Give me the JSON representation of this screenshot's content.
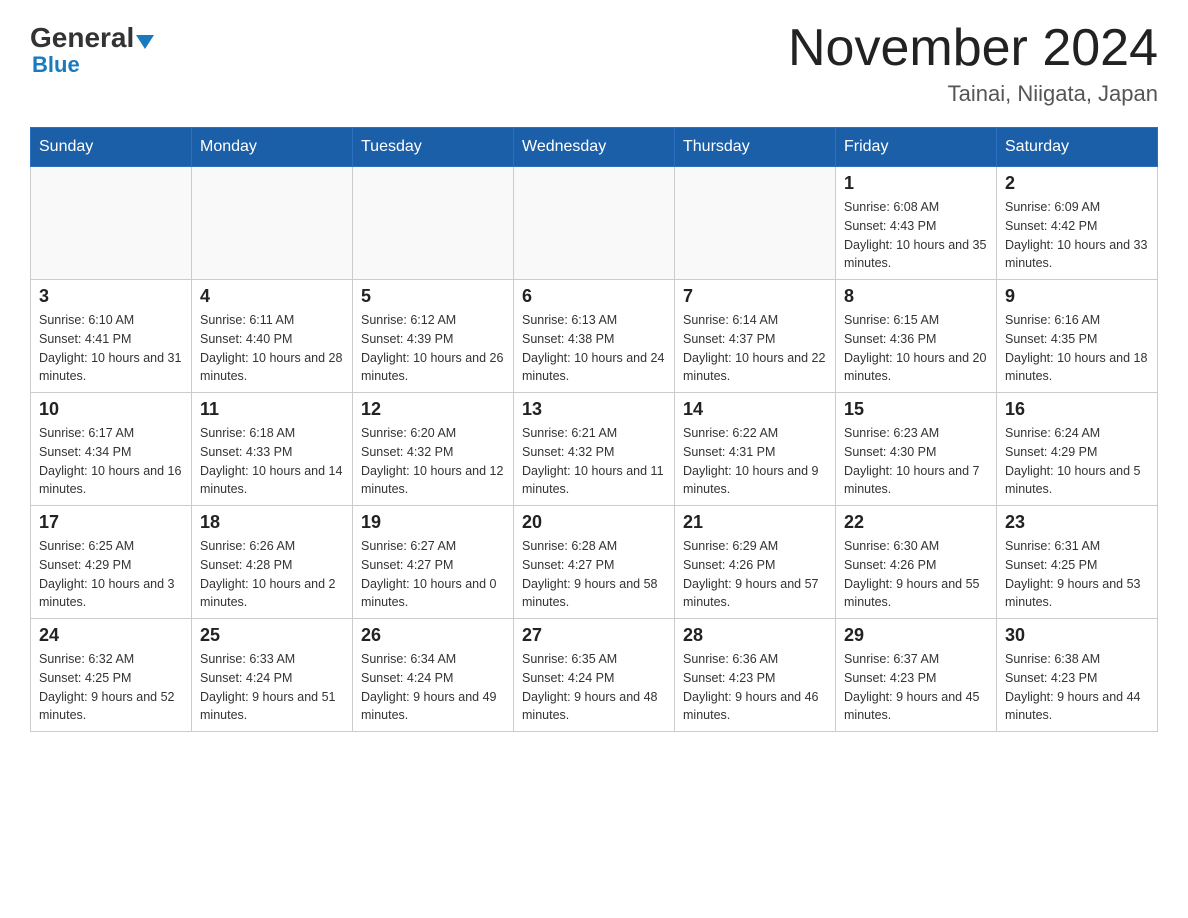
{
  "logo": {
    "general": "General",
    "blue": "Blue"
  },
  "header": {
    "title": "November 2024",
    "subtitle": "Tainai, Niigata, Japan"
  },
  "weekdays": [
    "Sunday",
    "Monday",
    "Tuesday",
    "Wednesday",
    "Thursday",
    "Friday",
    "Saturday"
  ],
  "weeks": [
    [
      {
        "day": "",
        "info": ""
      },
      {
        "day": "",
        "info": ""
      },
      {
        "day": "",
        "info": ""
      },
      {
        "day": "",
        "info": ""
      },
      {
        "day": "",
        "info": ""
      },
      {
        "day": "1",
        "info": "Sunrise: 6:08 AM\nSunset: 4:43 PM\nDaylight: 10 hours and 35 minutes."
      },
      {
        "day": "2",
        "info": "Sunrise: 6:09 AM\nSunset: 4:42 PM\nDaylight: 10 hours and 33 minutes."
      }
    ],
    [
      {
        "day": "3",
        "info": "Sunrise: 6:10 AM\nSunset: 4:41 PM\nDaylight: 10 hours and 31 minutes."
      },
      {
        "day": "4",
        "info": "Sunrise: 6:11 AM\nSunset: 4:40 PM\nDaylight: 10 hours and 28 minutes."
      },
      {
        "day": "5",
        "info": "Sunrise: 6:12 AM\nSunset: 4:39 PM\nDaylight: 10 hours and 26 minutes."
      },
      {
        "day": "6",
        "info": "Sunrise: 6:13 AM\nSunset: 4:38 PM\nDaylight: 10 hours and 24 minutes."
      },
      {
        "day": "7",
        "info": "Sunrise: 6:14 AM\nSunset: 4:37 PM\nDaylight: 10 hours and 22 minutes."
      },
      {
        "day": "8",
        "info": "Sunrise: 6:15 AM\nSunset: 4:36 PM\nDaylight: 10 hours and 20 minutes."
      },
      {
        "day": "9",
        "info": "Sunrise: 6:16 AM\nSunset: 4:35 PM\nDaylight: 10 hours and 18 minutes."
      }
    ],
    [
      {
        "day": "10",
        "info": "Sunrise: 6:17 AM\nSunset: 4:34 PM\nDaylight: 10 hours and 16 minutes."
      },
      {
        "day": "11",
        "info": "Sunrise: 6:18 AM\nSunset: 4:33 PM\nDaylight: 10 hours and 14 minutes."
      },
      {
        "day": "12",
        "info": "Sunrise: 6:20 AM\nSunset: 4:32 PM\nDaylight: 10 hours and 12 minutes."
      },
      {
        "day": "13",
        "info": "Sunrise: 6:21 AM\nSunset: 4:32 PM\nDaylight: 10 hours and 11 minutes."
      },
      {
        "day": "14",
        "info": "Sunrise: 6:22 AM\nSunset: 4:31 PM\nDaylight: 10 hours and 9 minutes."
      },
      {
        "day": "15",
        "info": "Sunrise: 6:23 AM\nSunset: 4:30 PM\nDaylight: 10 hours and 7 minutes."
      },
      {
        "day": "16",
        "info": "Sunrise: 6:24 AM\nSunset: 4:29 PM\nDaylight: 10 hours and 5 minutes."
      }
    ],
    [
      {
        "day": "17",
        "info": "Sunrise: 6:25 AM\nSunset: 4:29 PM\nDaylight: 10 hours and 3 minutes."
      },
      {
        "day": "18",
        "info": "Sunrise: 6:26 AM\nSunset: 4:28 PM\nDaylight: 10 hours and 2 minutes."
      },
      {
        "day": "19",
        "info": "Sunrise: 6:27 AM\nSunset: 4:27 PM\nDaylight: 10 hours and 0 minutes."
      },
      {
        "day": "20",
        "info": "Sunrise: 6:28 AM\nSunset: 4:27 PM\nDaylight: 9 hours and 58 minutes."
      },
      {
        "day": "21",
        "info": "Sunrise: 6:29 AM\nSunset: 4:26 PM\nDaylight: 9 hours and 57 minutes."
      },
      {
        "day": "22",
        "info": "Sunrise: 6:30 AM\nSunset: 4:26 PM\nDaylight: 9 hours and 55 minutes."
      },
      {
        "day": "23",
        "info": "Sunrise: 6:31 AM\nSunset: 4:25 PM\nDaylight: 9 hours and 53 minutes."
      }
    ],
    [
      {
        "day": "24",
        "info": "Sunrise: 6:32 AM\nSunset: 4:25 PM\nDaylight: 9 hours and 52 minutes."
      },
      {
        "day": "25",
        "info": "Sunrise: 6:33 AM\nSunset: 4:24 PM\nDaylight: 9 hours and 51 minutes."
      },
      {
        "day": "26",
        "info": "Sunrise: 6:34 AM\nSunset: 4:24 PM\nDaylight: 9 hours and 49 minutes."
      },
      {
        "day": "27",
        "info": "Sunrise: 6:35 AM\nSunset: 4:24 PM\nDaylight: 9 hours and 48 minutes."
      },
      {
        "day": "28",
        "info": "Sunrise: 6:36 AM\nSunset: 4:23 PM\nDaylight: 9 hours and 46 minutes."
      },
      {
        "day": "29",
        "info": "Sunrise: 6:37 AM\nSunset: 4:23 PM\nDaylight: 9 hours and 45 minutes."
      },
      {
        "day": "30",
        "info": "Sunrise: 6:38 AM\nSunset: 4:23 PM\nDaylight: 9 hours and 44 minutes."
      }
    ]
  ]
}
